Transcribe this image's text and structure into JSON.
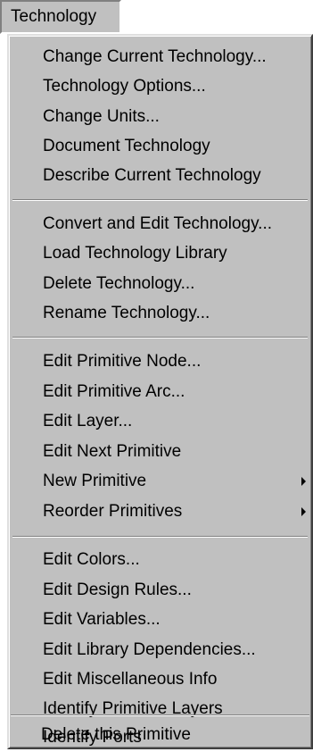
{
  "menu": {
    "title": "Technology",
    "groups": [
      [
        {
          "label": "Change Current Technology..."
        },
        {
          "label": "Technology Options..."
        },
        {
          "label": "Change Units..."
        },
        {
          "label": "Document Technology"
        },
        {
          "label": "Describe Current Technology"
        }
      ],
      [
        {
          "label": "Convert and Edit Technology..."
        },
        {
          "label": "Load Technology Library"
        },
        {
          "label": "Delete Technology..."
        },
        {
          "label": "Rename Technology..."
        }
      ],
      [
        {
          "label": "Edit Primitive Node..."
        },
        {
          "label": "Edit Primitive Arc..."
        },
        {
          "label": "Edit Layer..."
        },
        {
          "label": "Edit Next Primitive"
        },
        {
          "label": "New Primitive",
          "submenu": true
        },
        {
          "label": "Reorder Primitives",
          "submenu": true
        }
      ],
      [
        {
          "label": "Edit Colors..."
        },
        {
          "label": "Edit Design Rules..."
        },
        {
          "label": "Edit Variables..."
        },
        {
          "label": "Edit Library Dependencies..."
        },
        {
          "label": "Edit Miscellaneous Info"
        },
        {
          "label": "Identify Primitive Layers"
        },
        {
          "label": "Identify Ports"
        }
      ],
      [
        {
          "label": "Delete this Primitive"
        }
      ]
    ]
  }
}
